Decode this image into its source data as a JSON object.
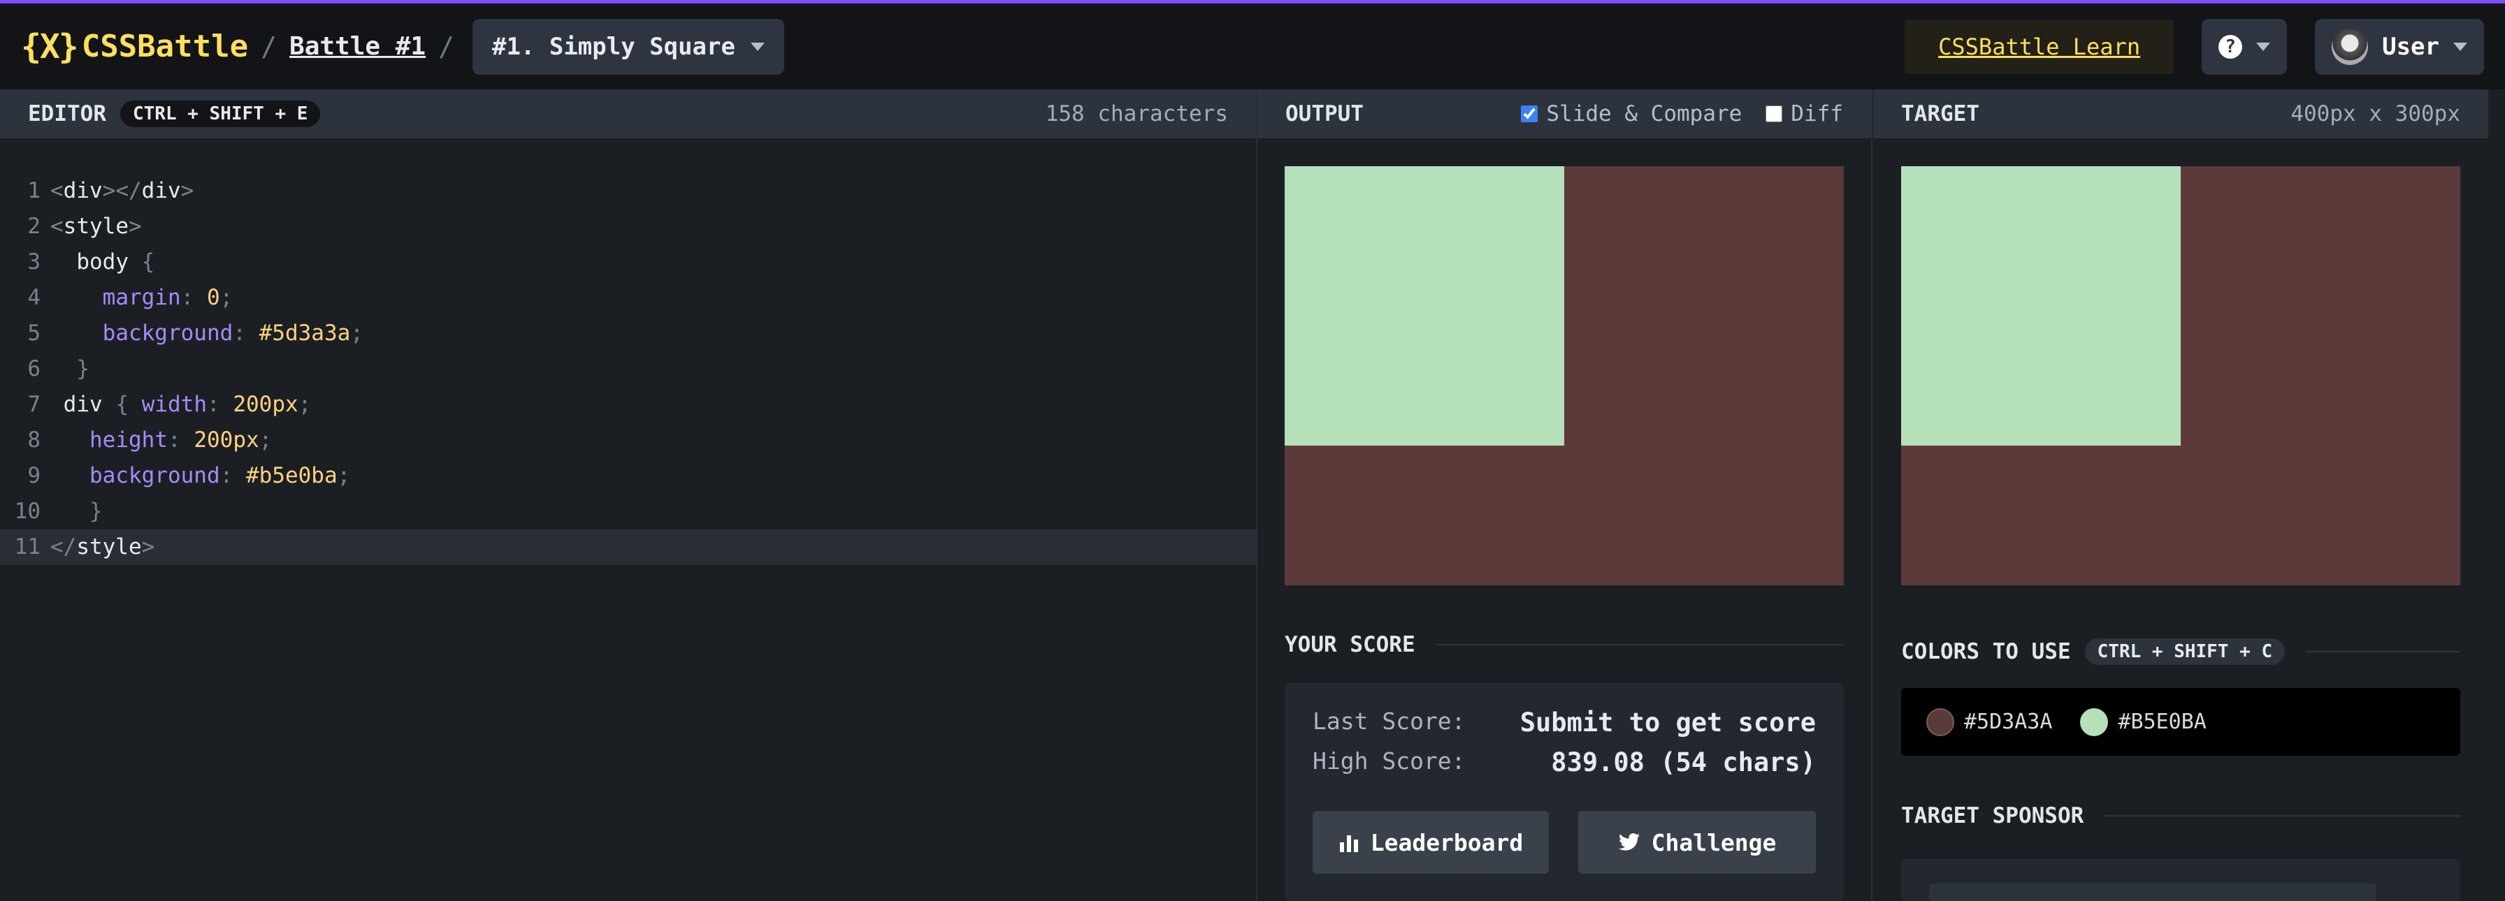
{
  "header": {
    "logo_mark": "{X}",
    "logo_text": "CSSBattle",
    "separator": "/",
    "battle_link": "Battle #1",
    "target_select": "#1. Simply Square",
    "learn_link": "CSSBattle Learn",
    "help_icon": "?",
    "user_label": "User"
  },
  "editor": {
    "title": "EDITOR",
    "shortcut": "CTRL + SHIFT + E",
    "char_count": "158 characters",
    "line_numbers": [
      "1",
      "2",
      "3",
      "4",
      "5",
      "6",
      "7",
      "8",
      "9",
      "10",
      "11"
    ]
  },
  "output": {
    "title": "OUTPUT",
    "slide_compare_label": "Slide & Compare",
    "slide_compare_checked": true,
    "diff_label": "Diff",
    "diff_checked": false
  },
  "target": {
    "title": "TARGET",
    "dimensions": "400px x 300px"
  },
  "score": {
    "title": "YOUR SCORE",
    "last_label": "Last Score:",
    "last_value": "Submit to get score",
    "high_label": "High Score:",
    "high_value": "839.08 (54 chars)",
    "leaderboard_button": "Leaderboard",
    "challenge_button": "Challenge"
  },
  "colors": {
    "title": "COLORS TO USE",
    "shortcut": "CTRL + SHIFT + C",
    "swatches": [
      {
        "hex": "#5D3A3A",
        "color": "#5d3a3a"
      },
      {
        "hex": "#B5E0BA",
        "color": "#b5e0ba"
      }
    ]
  },
  "sponsor": {
    "title": "TARGET SPONSOR"
  },
  "theme": {
    "accent": "#ffdf5d",
    "background": "#5d3a3a",
    "square": "#b5e0ba"
  }
}
